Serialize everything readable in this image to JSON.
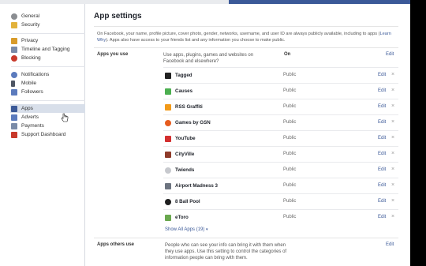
{
  "sidebar": {
    "groups": [
      {
        "items": [
          {
            "label": "General",
            "icon": "gear-icon",
            "color": "#8a8d91"
          },
          {
            "label": "Security",
            "icon": "badge-icon",
            "color": "#e2b23b"
          }
        ]
      },
      {
        "items": [
          {
            "label": "Privacy",
            "icon": "lock-icon",
            "color": "#d89b2a"
          },
          {
            "label": "Timeline and Tagging",
            "icon": "timeline-icon",
            "color": "#7a8ba8"
          },
          {
            "label": "Blocking",
            "icon": "blocking-icon",
            "color": "#c8392b"
          }
        ]
      },
      {
        "items": [
          {
            "label": "Notifications",
            "icon": "globe-icon",
            "color": "#5b7bbd"
          },
          {
            "label": "Mobile",
            "icon": "mobile-icon",
            "color": "#4d5563"
          },
          {
            "label": "Followers",
            "icon": "rss-icon",
            "color": "#5b7bbd"
          }
        ]
      },
      {
        "items": [
          {
            "label": "Apps",
            "icon": "apps-icon",
            "color": "#3b5998",
            "active": true
          },
          {
            "label": "Adverts",
            "icon": "adverts-icon",
            "color": "#5b7bbd"
          },
          {
            "label": "Payments",
            "icon": "payments-icon",
            "color": "#7a8ba8"
          },
          {
            "label": "Support Dashboard",
            "icon": "support-icon",
            "color": "#c8392b"
          }
        ]
      }
    ]
  },
  "main": {
    "title": "App settings",
    "intro_text": "On Facebook, your name, profile picture, cover photo, gender, networks, username, and user ID are always publicly available, including to apps (",
    "intro_link": "Learn Why",
    "intro_tail": "). Apps also have access to your friends list and any information you choose to make public.",
    "apps_you_use": {
      "label": "Apps you use",
      "description": "Use apps, plugins, games and websites on Facebook and elsewhere?",
      "state": "On",
      "edit_label": "Edit"
    },
    "apps": [
      {
        "name": "Tagged",
        "visibility": "Public",
        "edit": "Edit",
        "remove": "×",
        "icon": "tagged-icon",
        "color": "#222222"
      },
      {
        "name": "Causes",
        "visibility": "Public",
        "edit": "Edit",
        "remove": "×",
        "icon": "causes-icon",
        "color": "#4caf50"
      },
      {
        "name": "RSS Graffiti",
        "visibility": "Public",
        "edit": "Edit",
        "remove": "×",
        "icon": "rss-graffiti-icon",
        "color": "#f29a1a"
      },
      {
        "name": "Games by GSN",
        "visibility": "Public",
        "edit": "Edit",
        "remove": "×",
        "icon": "gsn-icon",
        "color": "#e65c1e"
      },
      {
        "name": "YouTube",
        "visibility": "Public",
        "edit": "Edit",
        "remove": "×",
        "icon": "youtube-icon",
        "color": "#d32f2f"
      },
      {
        "name": "CityVille",
        "visibility": "Public",
        "edit": "Edit",
        "remove": "×",
        "icon": "cityville-icon",
        "color": "#8e3b2a"
      },
      {
        "name": "Twiends",
        "visibility": "Public",
        "edit": "Edit",
        "remove": "×",
        "icon": "twiends-icon",
        "color": "#c7c9ce"
      },
      {
        "name": "Airport Madness 3",
        "visibility": "Public",
        "edit": "Edit",
        "remove": "×",
        "icon": "airplane-icon",
        "color": "#6d7480"
      },
      {
        "name": "8 Ball Pool",
        "visibility": "Public",
        "edit": "Edit",
        "remove": "×",
        "icon": "pool-ball-icon",
        "color": "#1f1f1f"
      },
      {
        "name": "eToro",
        "visibility": "Public",
        "edit": "Edit",
        "remove": "×",
        "icon": "etoro-icon",
        "color": "#6aa84f"
      }
    ],
    "show_all": "Show All Apps (19)",
    "show_all_caret": "▾",
    "apps_others_use": {
      "label": "Apps others use",
      "description": "People who can see your info can bring it with them when they use apps. Use this setting to control the categories of information people can bring with them.",
      "edit_label": "Edit"
    }
  }
}
